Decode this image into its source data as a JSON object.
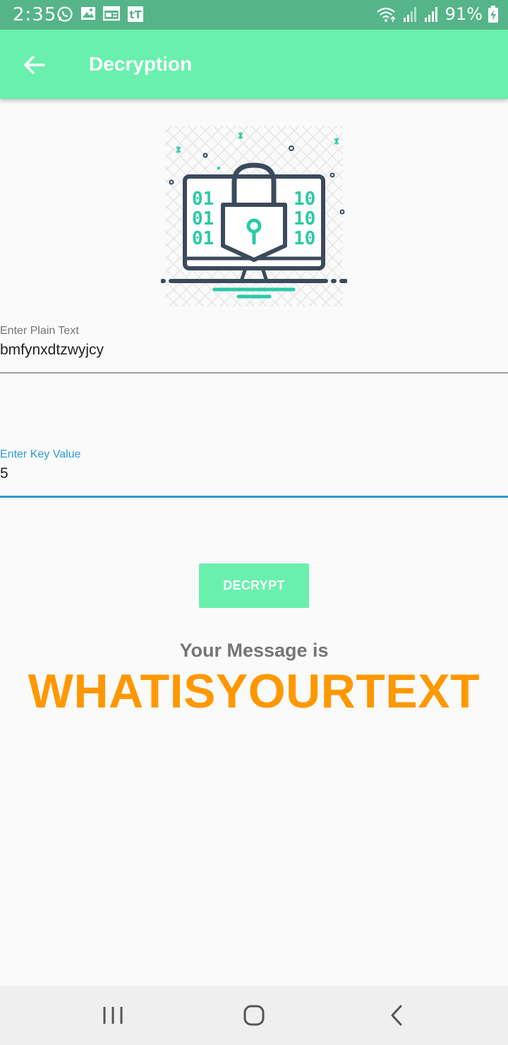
{
  "status_bar": {
    "time": "2:35",
    "battery_text": "91%",
    "icons": [
      "whatsapp-icon",
      "gallery-icon",
      "calendar-icon",
      "tt-icon",
      "wifi-icon",
      "signal-icon",
      "signal-icon",
      "battery-charging-icon"
    ]
  },
  "app_bar": {
    "title": "Decryption",
    "back_icon": "arrow-back-icon",
    "color": "#69f0ae"
  },
  "illustration": {
    "icon": "lock-laptop-icon",
    "binary_text": [
      "01",
      "01",
      "01",
      "10",
      "10",
      "10"
    ]
  },
  "plain_text_field": {
    "label": "Enter Plain Text",
    "value": "bmfynxdtzwyjcy"
  },
  "key_field": {
    "label": "Enter Key Value",
    "value": "5",
    "focused_color": "#2d9ad9"
  },
  "decrypt_button": {
    "label": "DECRYPT"
  },
  "result": {
    "heading": "Your Message is",
    "message": "WHATISYOURTEXT",
    "color": "#ff9800"
  },
  "nav_bar": {
    "recents_icon": "recents-icon",
    "home_icon": "home-icon",
    "back_icon": "nav-back-icon"
  }
}
